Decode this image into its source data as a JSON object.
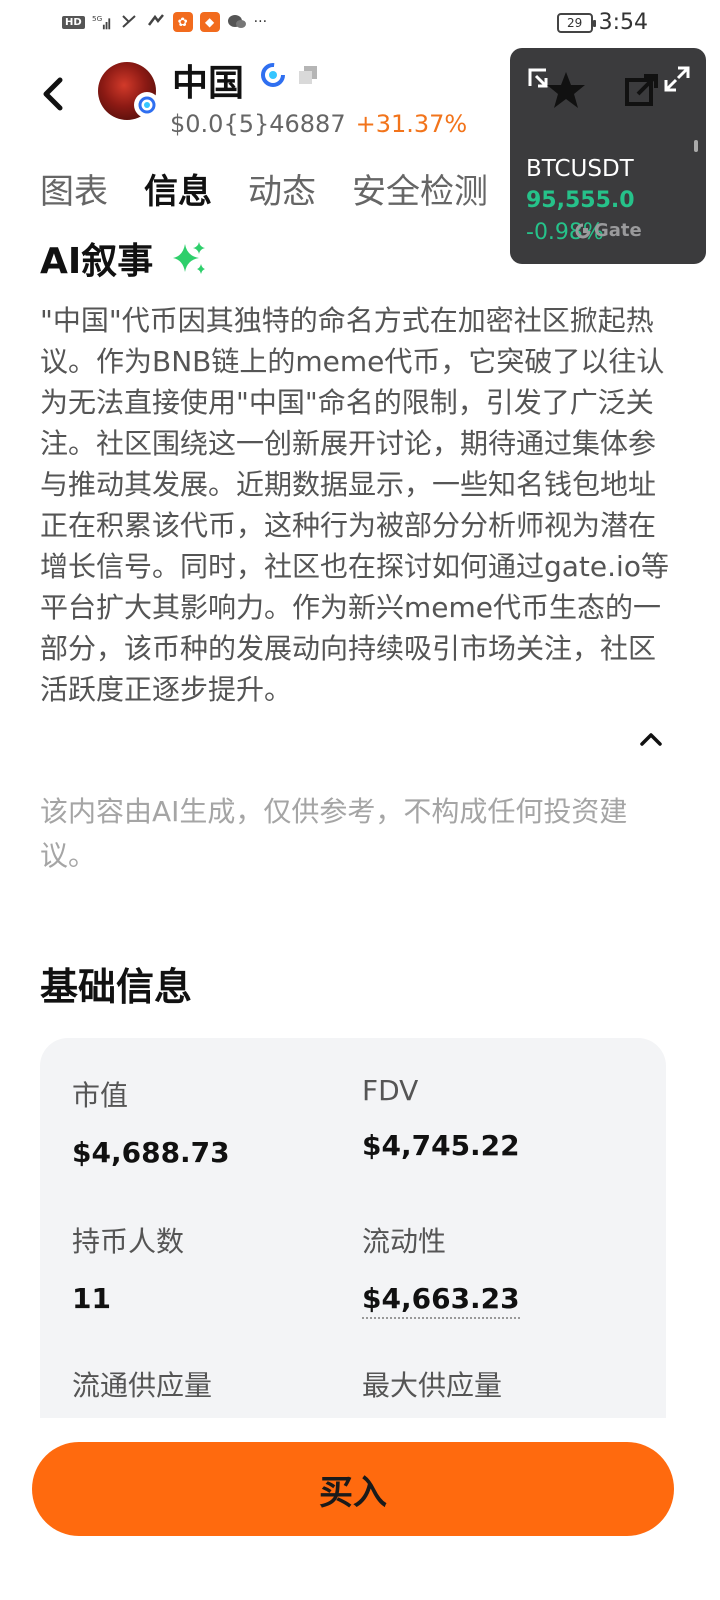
{
  "status_bar": {
    "hd": "HD",
    "signal": "5G",
    "battery": "29",
    "time": "3:54",
    "more": "···"
  },
  "header": {
    "token_name": "中国",
    "price": "$0.0{5}46887",
    "change": "+31.37%"
  },
  "tabs": [
    {
      "label": "图表",
      "active": false
    },
    {
      "label": "信息",
      "active": true
    },
    {
      "label": "动态",
      "active": false
    },
    {
      "label": "安全检测",
      "active": false
    }
  ],
  "widget": {
    "pair": "BTCUSDT",
    "price": "95,555.0",
    "change": "-0.98%",
    "brand": "Gate"
  },
  "ai_narrative": {
    "title": "AI叙事",
    "body": "\"中国\"代币因其独特的命名方式在加密社区掀起热议。作为BNB链上的meme代币，它突破了以往认为无法直接使用\"中国\"命名的限制，引发了广泛关注。社区围绕这一创新展开讨论，期待通过集体参与推动其发展。近期数据显示，一些知名钱包地址正在积累该代币，这种行为被部分分析师视为潜在增长信号。同时，社区也在探讨如何通过gate.io等平台扩大其影响力。作为新兴meme代币生态的一部分，该币种的发展动向持续吸引市场关注，社区活跃度正逐步提升。",
    "disclaimer": "该内容由AI生成，仅供参考，不构成任何投资建议。"
  },
  "basic_info": {
    "title": "基础信息",
    "market_cap_label": "市值",
    "market_cap_value": "$4,688.73",
    "fdv_label": "FDV",
    "fdv_value": "$4,745.22",
    "holders_label": "持币人数",
    "holders_value": "11",
    "liquidity_label": "流动性",
    "liquidity_value": "$4,663.23",
    "circulating_label": "流通供应量",
    "max_supply_label": "最大供应量"
  },
  "buy_button": {
    "label": "买入"
  },
  "colors": {
    "accent_orange": "#ff6a0e",
    "up_orange": "#f2741b",
    "green": "#26c28a",
    "widget_bg": "#3b3b3d"
  }
}
